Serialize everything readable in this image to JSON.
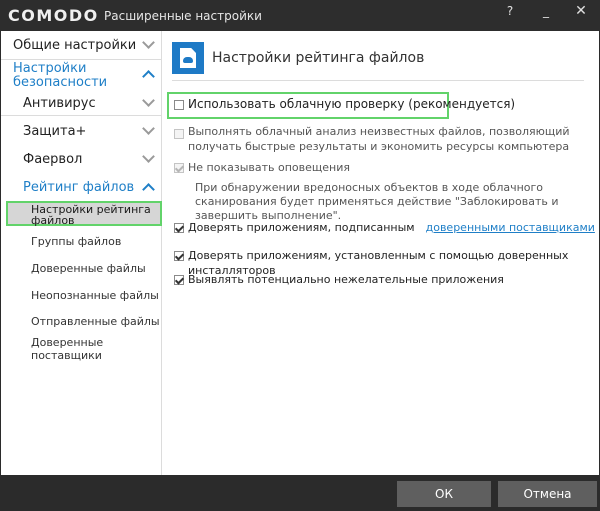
{
  "titlebar": {
    "brand": "COMODO",
    "title": "Расширенные настройки",
    "help": "?",
    "minimize": "_",
    "close": "✕"
  },
  "sidebar": {
    "general": "Общие настройки",
    "security": "Настройки безопасности",
    "antivirus": "Антивирус",
    "protection": "Защита+",
    "firewall": "Фаервол",
    "rating": "Рейтинг файлов",
    "rating_settings": "Настройки рейтинга файлов",
    "file_groups": "Группы файлов",
    "trusted_files": "Доверенные файлы",
    "unrecognized_files": "Неопознанные файлы",
    "submitted_files": "Отправленные файлы",
    "trusted_vendors": "Доверенные поставщики"
  },
  "main": {
    "title": "Настройки рейтинга файлов",
    "options": [
      {
        "label": "Использовать облачную проверку (рекомендуется)",
        "checked": false
      },
      {
        "label": "Выполнять облачный анализ неизвестных файлов, позволяющий получать быстрые результаты и экономить ресурсы компьютера",
        "checked": false
      },
      {
        "label": "Не показывать оповещения",
        "checked": true
      },
      {
        "label": "Доверять приложениям, подписанным",
        "link": "доверенными поставщиками",
        "checked": true
      },
      {
        "label": "Доверять приложениям, установленным с помощью доверенных инсталляторов",
        "checked": true
      },
      {
        "label": "Выявлять потенциально нежелательные приложения",
        "checked": true
      }
    ],
    "desc": "При обнаружении вредоносных объектов в ходе облачного сканирования будет применяться действие \"Заблокировать и завершить выполнение\"."
  },
  "footer": {
    "ok": "ОК",
    "cancel": "Отмена"
  },
  "colors": {
    "accent": "#1f7fc7",
    "highlight": "#62d36a",
    "titlebar": "#2d2d2d"
  }
}
